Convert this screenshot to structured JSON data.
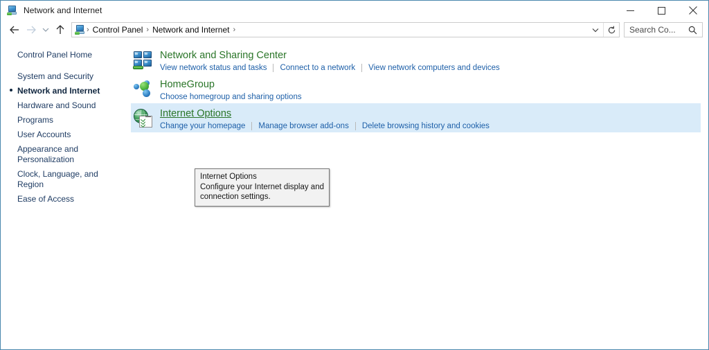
{
  "window": {
    "title": "Network and Internet",
    "title_icon": "network-computer-icon",
    "minimize_label": "Minimize",
    "maximize_label": "Maximize",
    "close_label": "Close",
    "border_color": "#4a87ad"
  },
  "addressbar": {
    "back_label": "Back",
    "forward_label": "Forward",
    "recent_label": "Recent locations",
    "up_label": "Up one level",
    "breadcrumb_icon": "network-computer-icon",
    "breadcrumb": [
      "Control Panel",
      "Network and Internet"
    ],
    "separator": "›",
    "dropdown_label": "Previous locations",
    "refresh_label": "Refresh",
    "search": {
      "placeholder": "Search Co...",
      "value": "",
      "icon": "search-icon"
    }
  },
  "sidebar": {
    "items": [
      {
        "label": "Control Panel Home",
        "active": false
      },
      {
        "label": "System and Security",
        "active": false
      },
      {
        "label": "Network and Internet",
        "active": true
      },
      {
        "label": "Hardware and Sound",
        "active": false
      },
      {
        "label": "Programs",
        "active": false
      },
      {
        "label": "User Accounts",
        "active": false
      },
      {
        "label": "Appearance and\nPersonalization",
        "active": false
      },
      {
        "label": "Clock, Language, and Region",
        "active": false
      },
      {
        "label": "Ease of Access",
        "active": false
      }
    ]
  },
  "main": {
    "categories": [
      {
        "title": "Network and Sharing Center",
        "icon": "network-sharing-center-icon",
        "selected": false,
        "links": [
          "View network status and tasks",
          "Connect to a network",
          "View network computers and devices"
        ]
      },
      {
        "title": "HomeGroup",
        "icon": "homegroup-icon",
        "selected": false,
        "links": [
          "Choose homegroup and sharing options"
        ]
      },
      {
        "title": "Internet Options",
        "icon": "internet-options-icon",
        "selected": true,
        "links": [
          "Change your homepage",
          "Manage browser add-ons",
          "Delete browsing history and cookies"
        ]
      }
    ]
  },
  "tooltip": {
    "title": "Internet Options",
    "line2": "Configure your Internet display and",
    "line3": "connection settings."
  },
  "colors": {
    "heading_green": "#2a7528",
    "link_blue": "#1d5fa8",
    "selection_blue": "#d9ebf9",
    "sidebar_text": "#1f3c63"
  }
}
